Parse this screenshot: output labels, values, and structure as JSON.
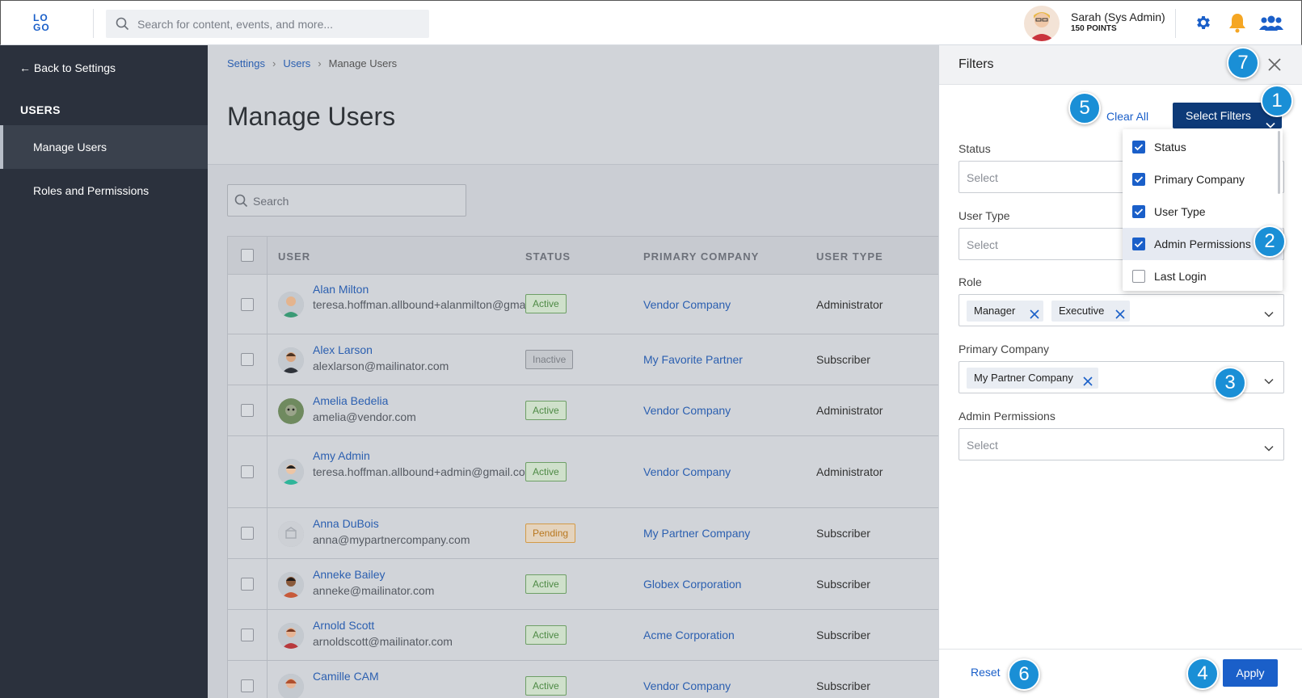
{
  "topbar": {
    "logo_text": "LO GO",
    "search_placeholder": "Search for content, events, and more...",
    "user_name": "Sarah (Sys Admin)",
    "user_points": "150 POINTS",
    "icons": [
      "settings-gear-icon",
      "notification-bell-icon",
      "users-group-icon"
    ]
  },
  "sidebar": {
    "back_label": "← Back to Settings",
    "section_heading": "USERS",
    "items": [
      {
        "label": "Manage Users",
        "active": true
      },
      {
        "label": "Roles and Permissions",
        "active": false
      }
    ]
  },
  "main": {
    "breadcrumb": [
      "Settings",
      "Users",
      "Manage Users"
    ],
    "title": "Manage Users",
    "search_placeholder": "Search",
    "columns": [
      "USER",
      "STATUS",
      "PRIMARY COMPANY",
      "USER TYPE"
    ],
    "rows": [
      {
        "name": "Alan Milton",
        "email": "teresa.hoffman.allbound+alanmilton@gmail.com",
        "status": "Active",
        "company": "Vendor Company",
        "type": "Administrator"
      },
      {
        "name": "Alex Larson",
        "email": "alexlarson@mailinator.com",
        "status": "Inactive",
        "company": "My Favorite Partner",
        "type": "Subscriber"
      },
      {
        "name": "Amelia Bedelia",
        "email": "amelia@vendor.com",
        "status": "Active",
        "company": "Vendor Company",
        "type": "Administrator"
      },
      {
        "name": "Amy Admin",
        "email": "teresa.hoffman.allbound+admin@gmail.com",
        "status": "Active",
        "company": "Vendor Company",
        "type": "Administrator"
      },
      {
        "name": "Anna DuBois",
        "email": "anna@mypartnercompany.com",
        "status": "Pending",
        "company": "My Partner Company",
        "type": "Subscriber"
      },
      {
        "name": "Anneke Bailey",
        "email": "anneke@mailinator.com",
        "status": "Active",
        "company": "Globex Corporation",
        "type": "Subscriber"
      },
      {
        "name": "Arnold Scott",
        "email": "arnoldscott@mailinator.com",
        "status": "Active",
        "company": "Acme Corporation",
        "type": "Subscriber"
      },
      {
        "name": "Camille CAM",
        "email": "",
        "status": "Active",
        "company": "Vendor Company",
        "type": "Subscriber"
      }
    ]
  },
  "filters": {
    "title": "Filters",
    "clear_all": "Clear All",
    "select_filters": "Select Filters",
    "select_placeholder": "Select",
    "fields": {
      "status": "Status",
      "user_type": "User Type",
      "role": "Role",
      "primary_company": "Primary Company",
      "admin_permissions": "Admin Permissions"
    },
    "role_chips": [
      "Manager",
      "Executive"
    ],
    "company_chips": [
      "My Partner Company"
    ],
    "dropdown_options": [
      {
        "label": "Status",
        "checked": true
      },
      {
        "label": "Primary Company",
        "checked": true
      },
      {
        "label": "User Type",
        "checked": true
      },
      {
        "label": "Admin Permissions",
        "checked": true
      },
      {
        "label": "Last Login",
        "checked": false
      }
    ],
    "reset": "Reset",
    "apply": "Apply"
  },
  "callouts": [
    "1",
    "2",
    "3",
    "4",
    "5",
    "6",
    "7"
  ],
  "colors": {
    "accent": "#1a5fc9",
    "sidebar_bg": "#2b313d",
    "primary_button": "#0d3a78",
    "callout": "#1a8fd6"
  }
}
